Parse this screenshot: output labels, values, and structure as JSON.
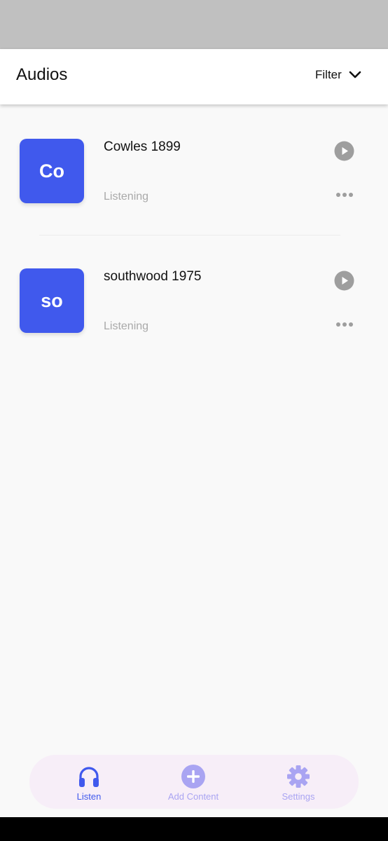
{
  "header": {
    "title": "Audios",
    "filter_label": "Filter"
  },
  "items": [
    {
      "initials": "Co",
      "title": "Cowles 1899",
      "status": "Listening"
    },
    {
      "initials": "so",
      "title": "southwood 1975",
      "status": "Listening"
    }
  ],
  "nav": {
    "listen": "Listen",
    "add_content": "Add Content",
    "settings": "Settings"
  },
  "colors": {
    "accent": "#4059ed",
    "nav_inactive": "#a9a4f2",
    "nav_background": "#f7eef8",
    "status_text": "#a9a9a9",
    "icon_gray": "#9e9e9e"
  },
  "icons": {
    "play": "play-circle-icon",
    "more": "more-horizontal-icon",
    "filter": "chevron-down-icon",
    "listen": "headphones-icon",
    "add": "add-circle-icon",
    "settings": "gear-icon"
  }
}
